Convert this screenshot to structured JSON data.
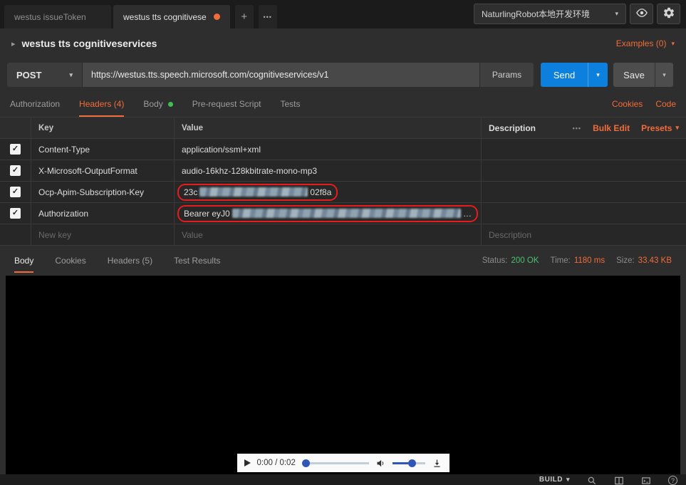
{
  "icons": {
    "chevron_down": "▾",
    "caret_right": "▸",
    "plus": "+",
    "ellipsis": "•••",
    "check": "✓",
    "question": "?"
  },
  "topbar": {
    "tabs": [
      {
        "label": "westus issueToken"
      },
      {
        "label": "westus tts cognitivese"
      }
    ],
    "environment": "NaturlingRobot本地开发环境"
  },
  "request_header": {
    "title": "westus tts cognitiveservices",
    "examples_label": "Examples (0)"
  },
  "request_bar": {
    "method": "POST",
    "url": "https://westus.tts.speech.microsoft.com/cognitiveservices/v1",
    "params_label": "Params",
    "send_label": "Send",
    "save_label": "Save"
  },
  "request_tabs": {
    "authorization": "Authorization",
    "headers": "Headers (4)",
    "body": "Body",
    "prerequest": "Pre-request Script",
    "tests": "Tests",
    "cookies_link": "Cookies",
    "code_link": "Code"
  },
  "headers_table": {
    "columns": {
      "key": "Key",
      "value": "Value",
      "description": "Description"
    },
    "bulk_edit_label": "Bulk Edit",
    "presets_label": "Presets",
    "rows": [
      {
        "key": "Content-Type",
        "value": "application/ssml+xml"
      },
      {
        "key": "X-Microsoft-OutputFormat",
        "value": "audio-16khz-128kbitrate-mono-mp3"
      },
      {
        "key": "Ocp-Apim-Subscription-Key",
        "value_prefix": "23c",
        "value_suffix": "02f8a"
      },
      {
        "key": "Authorization",
        "value_prefix": "Bearer eyJ0",
        "value_suffix": "…"
      }
    ],
    "placeholder_row": {
      "key": "New key",
      "value": "Value",
      "description": "Description"
    }
  },
  "response": {
    "tabs": {
      "body": "Body",
      "cookies": "Cookies",
      "headers": "Headers (5)",
      "test_results": "Test Results"
    },
    "status_label": "Status:",
    "status_value": "200 OK",
    "time_label": "Time:",
    "time_value": "1180 ms",
    "size_label": "Size:",
    "size_value": "33.43 KB"
  },
  "audio_player": {
    "time": "0:00 / 0:02"
  },
  "statusbar": {
    "build_label": "BUILD"
  },
  "colors": {
    "accent_orange": "#f26b3a",
    "send_blue": "#0d7fdc",
    "status_green": "#49c06e",
    "redact_border": "#e81c1c",
    "body_green_dot": "#3fbf4e"
  }
}
